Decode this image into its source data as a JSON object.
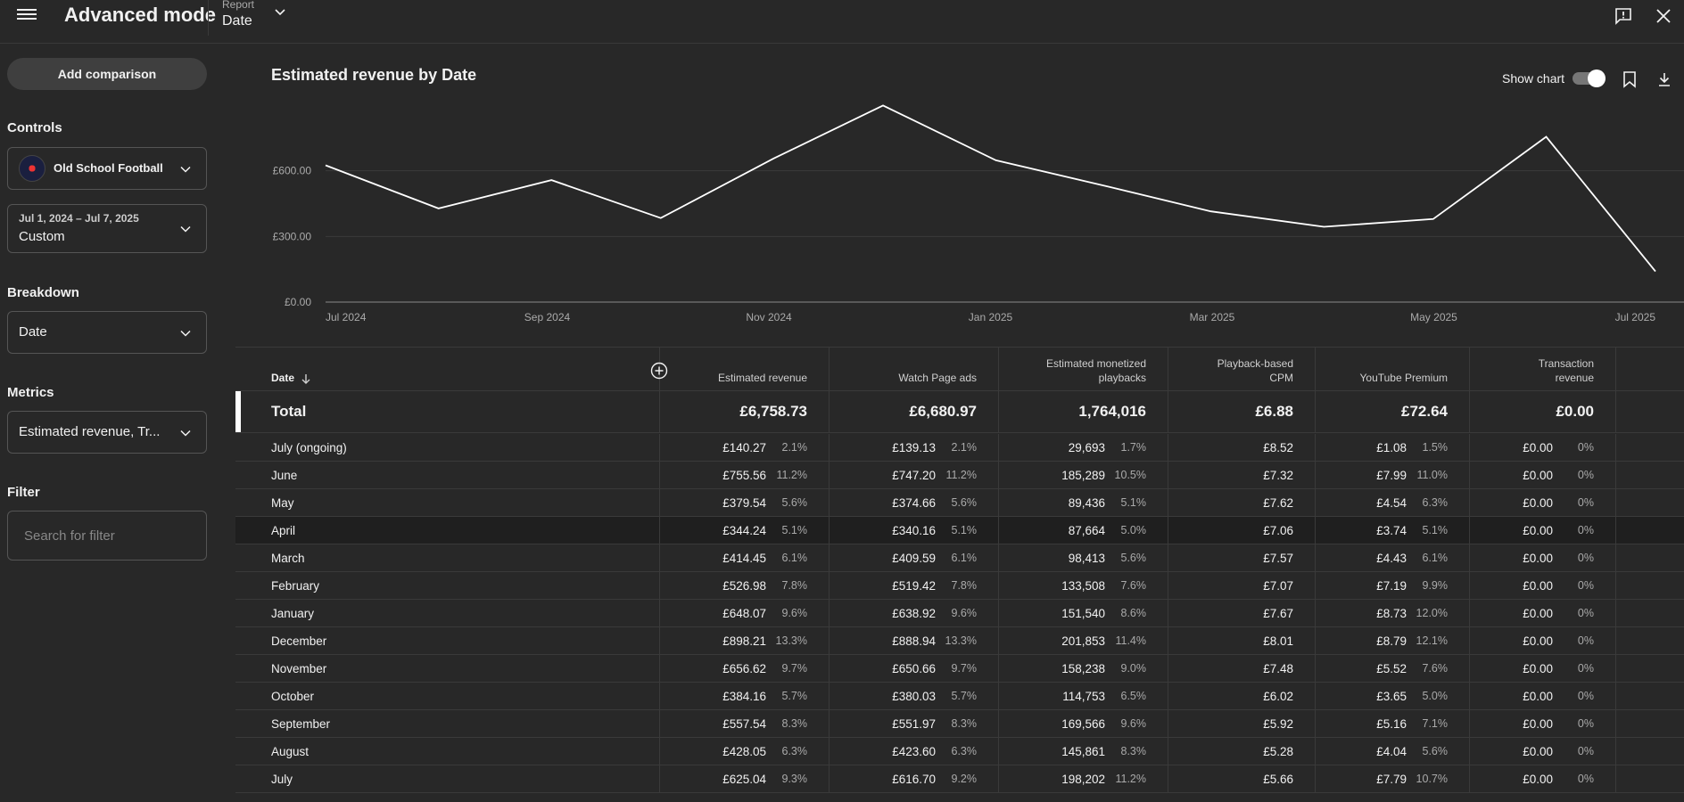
{
  "header": {
    "app_title": "Advanced mode",
    "report_label": "Report",
    "report_value": "Date"
  },
  "sidebar": {
    "add_comparison": "Add comparison",
    "controls_heading": "Controls",
    "channel_name": "Old School Football",
    "date_range": "Jul 1, 2024 – Jul 7, 2025",
    "date_preset": "Custom",
    "breakdown_heading": "Breakdown",
    "breakdown_value": "Date",
    "metrics_heading": "Metrics",
    "metrics_value": "Estimated revenue, Tr...",
    "filter_heading": "Filter",
    "filter_placeholder": "Search for filter"
  },
  "chart": {
    "title": "Estimated revenue by Date",
    "show_chart_label": "Show chart",
    "show_chart_on": true
  },
  "chart_data": {
    "type": "line",
    "title": "Estimated revenue by Date",
    "x_tick_labels": [
      "Jul 2024",
      "Sep 2024",
      "Nov 2024",
      "Jan 2025",
      "Mar 2025",
      "May 2025",
      "Jul 2025"
    ],
    "y_tick_labels": [
      "£0.00",
      "£300.00",
      "£600.00"
    ],
    "ylim": [
      0,
      900
    ],
    "grid": true,
    "series": [
      {
        "x": [
          "2024-07-01",
          "2024-08-01",
          "2024-09-01",
          "2024-10-01",
          "2024-11-01",
          "2024-12-01",
          "2025-01-01",
          "2025-02-01",
          "2025-03-01",
          "2025-04-01",
          "2025-05-01",
          "2025-06-01",
          "2025-07-01"
        ],
        "values": [
          625.04,
          428.05,
          557.54,
          384.16,
          656.62,
          898.21,
          648.07,
          526.98,
          414.45,
          344.24,
          379.54,
          755.56,
          140.27
        ]
      }
    ]
  },
  "table": {
    "columns": [
      "Date",
      "Estimated revenue",
      "Watch Page ads",
      "Estimated monetized playbacks",
      "Playback-based CPM",
      "YouTube Premium",
      "Transaction revenue"
    ],
    "total": {
      "label": "Total",
      "values": [
        "£6,758.73",
        "£6,680.97",
        "1,764,016",
        "£6.88",
        "£72.64",
        "£0.00"
      ]
    },
    "rows": [
      {
        "date": "July (ongoing)",
        "rev": "£140.27",
        "rev_pct": "2.1%",
        "wpa": "£139.13",
        "wpa_pct": "2.1%",
        "emp": "29,693",
        "emp_pct": "1.7%",
        "cpm": "£8.52",
        "ytp": "£1.08",
        "ytp_pct": "1.5%",
        "tr": "£0.00",
        "tr_pct": "0%"
      },
      {
        "date": "June",
        "rev": "£755.56",
        "rev_pct": "11.2%",
        "wpa": "£747.20",
        "wpa_pct": "11.2%",
        "emp": "185,289",
        "emp_pct": "10.5%",
        "cpm": "£7.32",
        "ytp": "£7.99",
        "ytp_pct": "11.0%",
        "tr": "£0.00",
        "tr_pct": "0%"
      },
      {
        "date": "May",
        "rev": "£379.54",
        "rev_pct": "5.6%",
        "wpa": "£374.66",
        "wpa_pct": "5.6%",
        "emp": "89,436",
        "emp_pct": "5.1%",
        "cpm": "£7.62",
        "ytp": "£4.54",
        "ytp_pct": "6.3%",
        "tr": "£0.00",
        "tr_pct": "0%"
      },
      {
        "date": "April",
        "rev": "£344.24",
        "rev_pct": "5.1%",
        "wpa": "£340.16",
        "wpa_pct": "5.1%",
        "emp": "87,664",
        "emp_pct": "5.0%",
        "cpm": "£7.06",
        "ytp": "£3.74",
        "ytp_pct": "5.1%",
        "tr": "£0.00",
        "tr_pct": "0%"
      },
      {
        "date": "March",
        "rev": "£414.45",
        "rev_pct": "6.1%",
        "wpa": "£409.59",
        "wpa_pct": "6.1%",
        "emp": "98,413",
        "emp_pct": "5.6%",
        "cpm": "£7.57",
        "ytp": "£4.43",
        "ytp_pct": "6.1%",
        "tr": "£0.00",
        "tr_pct": "0%"
      },
      {
        "date": "February",
        "rev": "£526.98",
        "rev_pct": "7.8%",
        "wpa": "£519.42",
        "wpa_pct": "7.8%",
        "emp": "133,508",
        "emp_pct": "7.6%",
        "cpm": "£7.07",
        "ytp": "£7.19",
        "ytp_pct": "9.9%",
        "tr": "£0.00",
        "tr_pct": "0%"
      },
      {
        "date": "January",
        "rev": "£648.07",
        "rev_pct": "9.6%",
        "wpa": "£638.92",
        "wpa_pct": "9.6%",
        "emp": "151,540",
        "emp_pct": "8.6%",
        "cpm": "£7.67",
        "ytp": "£8.73",
        "ytp_pct": "12.0%",
        "tr": "£0.00",
        "tr_pct": "0%"
      },
      {
        "date": "December",
        "rev": "£898.21",
        "rev_pct": "13.3%",
        "wpa": "£888.94",
        "wpa_pct": "13.3%",
        "emp": "201,853",
        "emp_pct": "11.4%",
        "cpm": "£8.01",
        "ytp": "£8.79",
        "ytp_pct": "12.1%",
        "tr": "£0.00",
        "tr_pct": "0%"
      },
      {
        "date": "November",
        "rev": "£656.62",
        "rev_pct": "9.7%",
        "wpa": "£650.66",
        "wpa_pct": "9.7%",
        "emp": "158,238",
        "emp_pct": "9.0%",
        "cpm": "£7.48",
        "ytp": "£5.52",
        "ytp_pct": "7.6%",
        "tr": "£0.00",
        "tr_pct": "0%"
      },
      {
        "date": "October",
        "rev": "£384.16",
        "rev_pct": "5.7%",
        "wpa": "£380.03",
        "wpa_pct": "5.7%",
        "emp": "114,753",
        "emp_pct": "6.5%",
        "cpm": "£6.02",
        "ytp": "£3.65",
        "ytp_pct": "5.0%",
        "tr": "£0.00",
        "tr_pct": "0%"
      },
      {
        "date": "September",
        "rev": "£557.54",
        "rev_pct": "8.3%",
        "wpa": "£551.97",
        "wpa_pct": "8.3%",
        "emp": "169,566",
        "emp_pct": "9.6%",
        "cpm": "£5.92",
        "ytp": "£5.16",
        "ytp_pct": "7.1%",
        "tr": "£0.00",
        "tr_pct": "0%"
      },
      {
        "date": "August",
        "rev": "£428.05",
        "rev_pct": "6.3%",
        "wpa": "£423.60",
        "wpa_pct": "6.3%",
        "emp": "145,861",
        "emp_pct": "8.3%",
        "cpm": "£5.28",
        "ytp": "£4.04",
        "ytp_pct": "5.6%",
        "tr": "£0.00",
        "tr_pct": "0%"
      },
      {
        "date": "July",
        "rev": "£625.04",
        "rev_pct": "9.3%",
        "wpa": "£616.70",
        "wpa_pct": "9.2%",
        "emp": "198,202",
        "emp_pct": "11.2%",
        "cpm": "£5.66",
        "ytp": "£7.79",
        "ytp_pct": "10.7%",
        "tr": "£0.00",
        "tr_pct": "0%"
      }
    ],
    "highlighted_row_index": 3
  },
  "colors": {
    "background": "#282828",
    "line": "#ffffff",
    "gridline": "#3a3a3a",
    "divider": "#3a3a3a"
  },
  "icons": [
    "menu-icon",
    "chevron-down-icon",
    "feedback-icon",
    "close-icon",
    "bookmark-icon",
    "download-icon",
    "sort-down-icon",
    "add-column-icon"
  ]
}
